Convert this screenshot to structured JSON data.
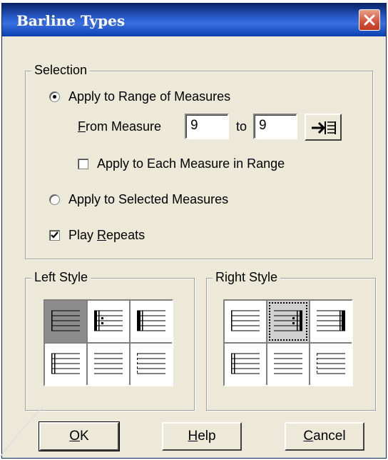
{
  "dialog": {
    "title": "Barline Types"
  },
  "selection": {
    "legend": "Selection",
    "range_option": "Apply to Range of Measures",
    "range_option_selected": true,
    "from_label": "From Measure",
    "from_value": "9",
    "to_label": "to",
    "to_value": "9",
    "each_measure_label": "Apply to Each Measure in Range",
    "each_measure_checked": false,
    "selected_option": "Apply to Selected Measures",
    "selected_option_selected": false,
    "play_repeats_label": "Play Repeats",
    "play_repeats_checked": true,
    "arrow_icon": "arrow-to-barline-icon"
  },
  "left_style": {
    "legend": "Left Style",
    "selected_index": 0,
    "cells": [
      "normal-barline-icon",
      "repeat-start-barline-icon",
      "thick-start-barline-icon",
      "double-barline-icon",
      "no-barline-icon",
      "dashed-barline-icon"
    ]
  },
  "right_style": {
    "legend": "Right Style",
    "selected_index": 1,
    "cells": [
      "normal-barline-icon",
      "repeat-end-barline-icon",
      "final-barline-icon",
      "double-barline-icon",
      "no-barline-icon",
      "dashed-barline-icon"
    ]
  },
  "buttons": {
    "ok_prefix": "",
    "ok_mnemonic": "O",
    "ok_rest": "K",
    "help_mnemonic": "H",
    "help_rest": "elp",
    "cancel_mnemonic": "C",
    "cancel_rest": "ancel"
  }
}
